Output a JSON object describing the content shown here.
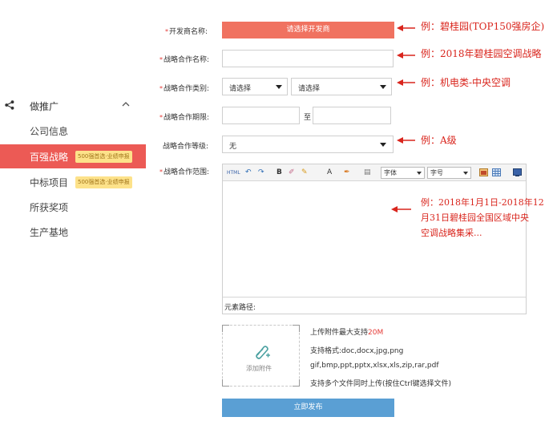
{
  "sidebar": {
    "head": "做推广",
    "items": [
      {
        "label": "公司信息"
      },
      {
        "label": "百强战略",
        "badge": "500强首选·业绩申报"
      },
      {
        "label": "中标项目",
        "badge": "500强首选·业绩申报"
      },
      {
        "label": "所获奖项"
      },
      {
        "label": "生产基地"
      }
    ]
  },
  "form": {
    "developer_label": "开发商名称:",
    "developer_button": "请选择开发商",
    "name_label": "战略合作名称:",
    "name_value": "",
    "category_label": "战略合作类别:",
    "category_select1": "请选择",
    "category_select2": "请选择",
    "period_label": "战略合作期限:",
    "period_sep": "至",
    "level_label": "战略合作等级:",
    "level_value": "无",
    "scope_label": "战略合作范围:"
  },
  "editor": {
    "tools": [
      "HTML",
      "↶",
      "↷",
      "B",
      "✐",
      "✎",
      "A",
      "✒",
      "▤"
    ],
    "font_select": "字体",
    "size_select": "字号",
    "path_label": "元素路径:"
  },
  "upload": {
    "add_label": "添加附件",
    "max_prefix": "上传附件最大支持",
    "max_value": "20M",
    "formats1": "支持格式:doc,docx,jpg,png",
    "formats2": "gif,bmp,ppt,pptx,xlsx,xls,zip,rar,pdf",
    "multi": "支持多个文件同时上传(按住Ctrl键选择文件)"
  },
  "submit_label": "立即发布",
  "annotations": {
    "developer": "例：碧桂园(TOP150强房企)",
    "name": "例：2018年碧桂园空调战略",
    "category": "例：机电类-中央空调",
    "level": "例：A级",
    "scope_line1": "例：2018年1月1日-2018年12",
    "scope_line2": "月31日碧桂园全国区域中央",
    "scope_line3": "空调战略集采..."
  },
  "colors": {
    "accent_red": "#ec5a55",
    "developer_button": "#f07260",
    "submit": "#5a9fd4",
    "annotation": "#d9251d",
    "badge": "#fde28a"
  }
}
